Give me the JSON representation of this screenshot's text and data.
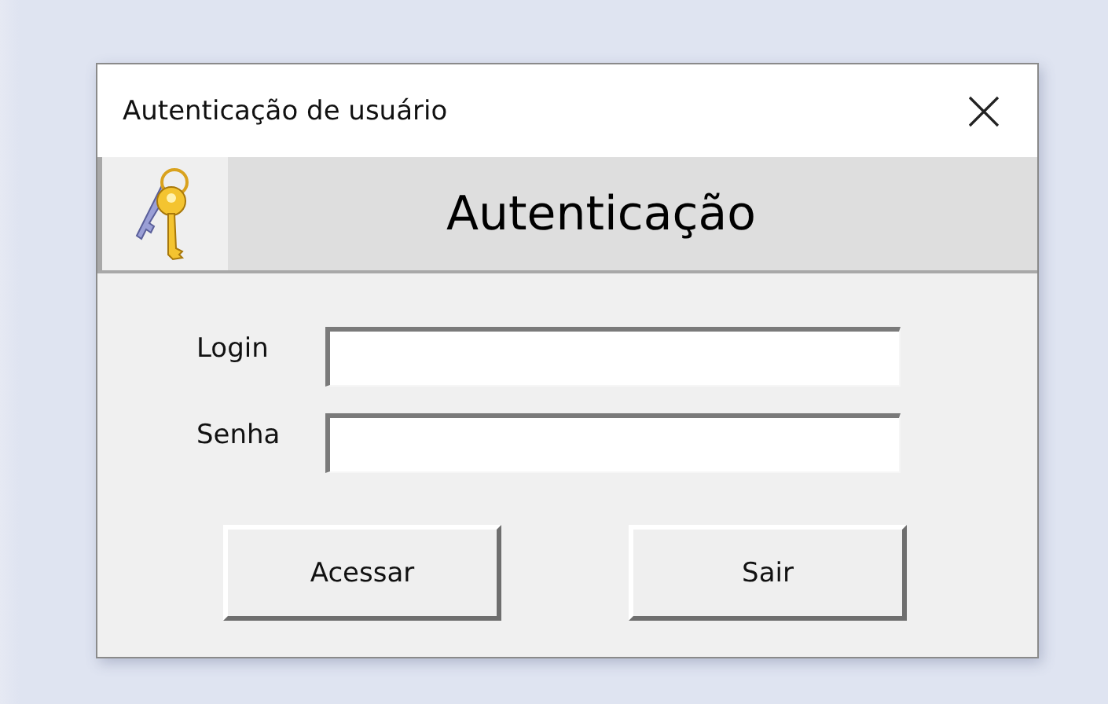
{
  "window": {
    "title": "Autenticação de usuário"
  },
  "header": {
    "title": "Autenticação"
  },
  "fields": [
    {
      "label": "Login"
    },
    {
      "label": "Senha"
    }
  ],
  "buttons": [
    "Acessar",
    "Sair"
  ]
}
